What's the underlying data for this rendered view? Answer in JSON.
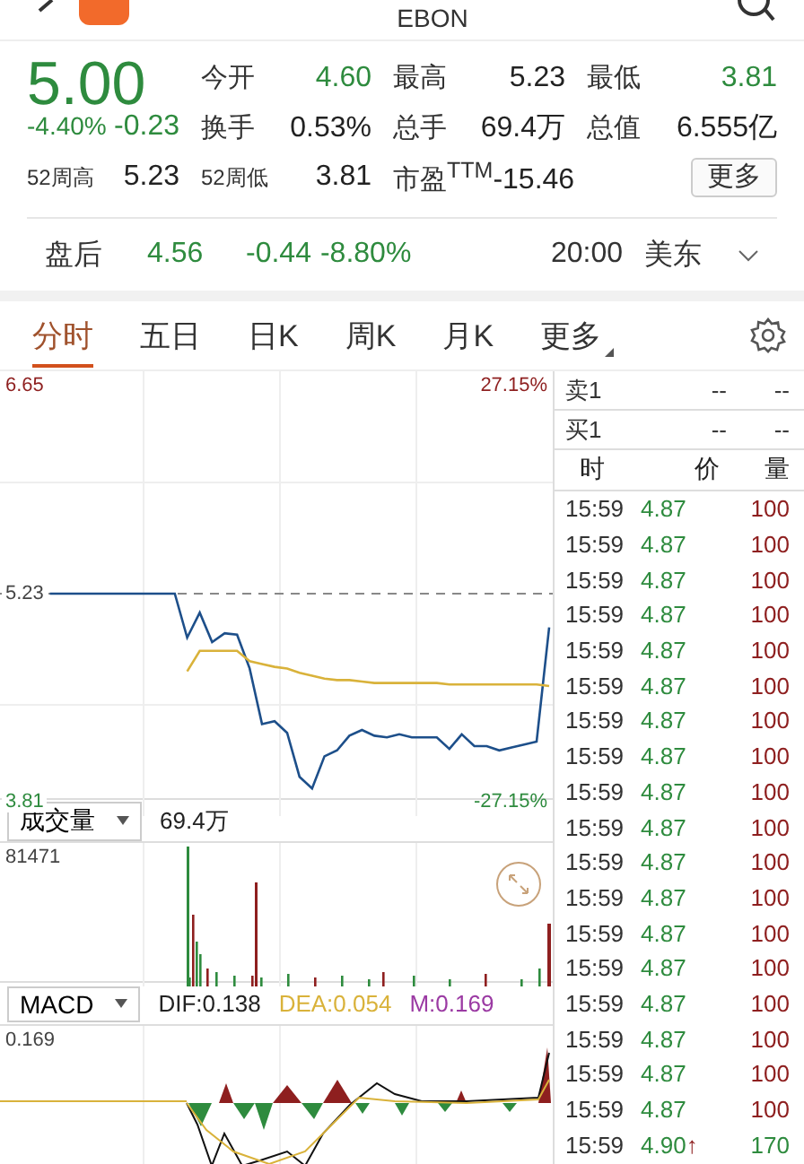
{
  "header": {
    "symbol": "EBON"
  },
  "quote": {
    "price": "5.00",
    "change_pct": "-4.40%",
    "change": "-0.23",
    "stats": [
      {
        "label": "今开",
        "value": "4.60",
        "color": "#2e8b3e"
      },
      {
        "label": "最高",
        "value": "5.23",
        "color": "#222222"
      },
      {
        "label": "最低",
        "value": "3.81",
        "color": "#2e8b3e"
      },
      {
        "label": "换手",
        "value": "0.53%",
        "color": "#222222"
      },
      {
        "label": "总手",
        "value": "69.4万",
        "color": "#222222"
      },
      {
        "label": "总值",
        "value": "6.555亿",
        "color": "#222222"
      }
    ],
    "year_stats": [
      {
        "label": "52周高",
        "value": "5.23"
      },
      {
        "label": "52周低",
        "value": "3.81"
      }
    ],
    "pe": {
      "label": "市盈$^{TTM}$",
      "value": "-15.46"
    },
    "more_button": "更多"
  },
  "after_hours": {
    "label": "盘后",
    "price": "4.56",
    "change": "-0.44",
    "change_pct": "-8.80%",
    "time": "20:00",
    "zone": "美东"
  },
  "tabs": [
    {
      "label": "分时",
      "selected": true,
      "kind": "plain"
    },
    {
      "label": "五日",
      "selected": false,
      "kind": "plain"
    },
    {
      "label": "日K",
      "selected": false,
      "kind": "plain"
    },
    {
      "label": "周K",
      "selected": false,
      "kind": "plain"
    },
    {
      "label": "月K",
      "selected": false,
      "kind": "plain"
    },
    {
      "label": "更多",
      "selected": false,
      "kind": "menu"
    }
  ],
  "price_chart": {
    "high_pct": "27.15%",
    "low_pct": "-27.15%",
    "chart_data": {
      "type": "line",
      "ylim": [
        3.81,
        6.65
      ],
      "yticks": [
        3.81,
        5.23,
        6.65
      ],
      "ref_lines": [
        {
          "axis": "y",
          "value": 5.23
        }
      ],
      "categories": [
        null,
        null,
        null,
        null,
        null,
        null,
        null,
        null,
        null,
        null,
        null,
        null,
        null,
        null,
        null,
        null,
        null,
        null,
        null,
        null,
        null,
        null,
        null,
        null,
        null,
        null,
        null,
        null,
        null,
        null,
        null,
        null,
        null,
        null,
        null,
        null,
        null,
        null,
        null,
        null,
        null,
        null,
        null,
        null,
        null
      ],
      "series": [
        {
          "color": "#1d4f8a",
          "values": [
            null,
            null,
            null,
            null,
            5.23,
            5.23,
            5.23,
            5.23,
            5.23,
            5.23,
            5.23,
            5.23,
            5.23,
            5.23,
            5.23,
            4.93,
            5.1,
            4.9,
            4.96,
            4.95,
            4.72,
            4.34,
            4.36,
            4.28,
            3.98,
            3.9,
            4.12,
            4.16,
            4.26,
            4.3,
            4.26,
            4.25,
            4.27,
            4.25,
            4.25,
            4.25,
            4.17,
            4.27,
            4.19,
            4.19,
            4.16,
            4.18,
            4.2,
            4.22,
            5.0
          ]
        },
        {
          "color": "#d9b23a",
          "values": [
            null,
            null,
            null,
            null,
            null,
            null,
            null,
            null,
            null,
            null,
            null,
            null,
            null,
            null,
            null,
            4.7,
            4.84,
            4.84,
            4.84,
            4.84,
            4.77,
            4.75,
            4.73,
            4.72,
            4.69,
            4.67,
            4.65,
            4.64,
            4.64,
            4.63,
            4.62,
            4.62,
            4.62,
            4.62,
            4.62,
            4.62,
            4.61,
            4.61,
            4.61,
            4.61,
            4.61,
            4.61,
            4.61,
            4.61,
            4.6
          ]
        }
      ]
    }
  },
  "volume": {
    "selector": "成交量",
    "total": "69.4万",
    "max": "81471"
  },
  "macd": {
    "selector": "MACD",
    "dif": "DIF:0.138",
    "dea": "DEA:0.054",
    "m": "M:0.169",
    "max": "0.169"
  },
  "order_book": [
    {
      "label": "卖1",
      "price": "--",
      "volume": "--"
    },
    {
      "label": "买1",
      "price": "--",
      "volume": "--"
    }
  ],
  "trades": {
    "columns": [
      "时",
      "价",
      "量"
    ],
    "rows": [
      {
        "time": "15:59",
        "price": "4.87",
        "volume": "100",
        "color": "#8e1f1f"
      },
      {
        "time": "15:59",
        "price": "4.87",
        "volume": "100",
        "color": "#8e1f1f"
      },
      {
        "time": "15:59",
        "price": "4.87",
        "volume": "100",
        "color": "#8e1f1f"
      },
      {
        "time": "15:59",
        "price": "4.87",
        "volume": "100",
        "color": "#8e1f1f"
      },
      {
        "time": "15:59",
        "price": "4.87",
        "volume": "100",
        "color": "#8e1f1f"
      },
      {
        "time": "15:59",
        "price": "4.87",
        "volume": "100",
        "color": "#8e1f1f"
      },
      {
        "time": "15:59",
        "price": "4.87",
        "volume": "100",
        "color": "#8e1f1f"
      },
      {
        "time": "15:59",
        "price": "4.87",
        "volume": "100",
        "color": "#8e1f1f"
      },
      {
        "time": "15:59",
        "price": "4.87",
        "volume": "100",
        "color": "#8e1f1f"
      },
      {
        "time": "15:59",
        "price": "4.87",
        "volume": "100",
        "color": "#8e1f1f"
      },
      {
        "time": "15:59",
        "price": "4.87",
        "volume": "100",
        "color": "#8e1f1f"
      },
      {
        "time": "15:59",
        "price": "4.87",
        "volume": "100",
        "color": "#8e1f1f"
      },
      {
        "time": "15:59",
        "price": "4.87",
        "volume": "100",
        "color": "#8e1f1f"
      },
      {
        "time": "15:59",
        "price": "4.87",
        "volume": "100",
        "color": "#8e1f1f"
      },
      {
        "time": "15:59",
        "price": "4.87",
        "volume": "100",
        "color": "#8e1f1f"
      },
      {
        "time": "15:59",
        "price": "4.87",
        "volume": "100",
        "color": "#8e1f1f"
      },
      {
        "time": "15:59",
        "price": "4.87",
        "volume": "100",
        "color": "#8e1f1f"
      },
      {
        "time": "15:59",
        "price": "4.87",
        "volume": "100",
        "color": "#8e1f1f"
      },
      {
        "time": "15:59",
        "price": "4.90",
        "arrow": "↑",
        "volume": "170",
        "color": "#2e8b3e"
      }
    ]
  }
}
